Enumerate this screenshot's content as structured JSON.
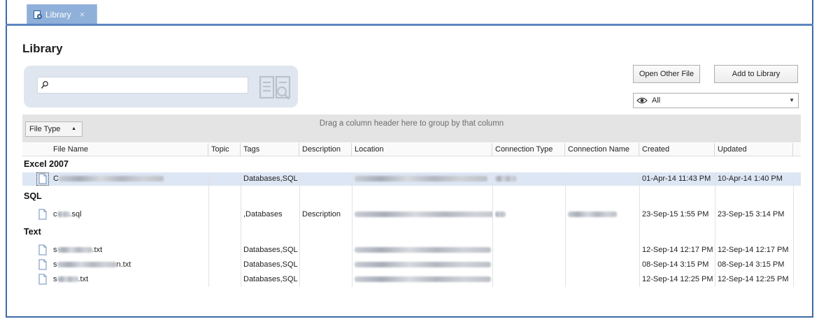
{
  "tab": {
    "label": "Library",
    "close": "×"
  },
  "page": {
    "title": "Library"
  },
  "search": {
    "value": "",
    "placeholder": ""
  },
  "buttons": {
    "open_other_file": "Open Other File",
    "add_to_library": "Add to Library"
  },
  "filter": {
    "selected": "All"
  },
  "grouping": {
    "hint": "Drag a column header here to group by that column",
    "chip_label": "File Type",
    "chip_sort": "▲"
  },
  "columns": [
    "File Name",
    "Topic",
    "Tags",
    "Description",
    "Location",
    "Connection Type",
    "Connection Name",
    "Created",
    "Updated"
  ],
  "groups": [
    {
      "name": "Excel 2007",
      "rows": [
        {
          "file_prefix": "C",
          "file_suffix": "",
          "topic": "",
          "tags": "Databases,SQL",
          "description": "",
          "created": "01-Apr-14 11:43 PM",
          "updated": "10-Apr-14 1:40 PM",
          "selected": true
        }
      ]
    },
    {
      "name": "SQL",
      "rows": [
        {
          "file_prefix": "c",
          "file_suffix": ".sql",
          "topic": "",
          "tags": ",Databases",
          "description": "Description",
          "created": "23-Sep-15 1:55 PM",
          "updated": "23-Sep-15 3:14 PM",
          "selected": false
        }
      ]
    },
    {
      "name": "Text",
      "rows": [
        {
          "file_prefix": "s",
          "file_suffix": ".txt",
          "topic": "",
          "tags": "Databases,SQL",
          "description": "",
          "created": "12-Sep-14 12:17 PM",
          "updated": "12-Sep-14 12:17 PM",
          "selected": false
        },
        {
          "file_prefix": "s",
          "file_suffix": "n.txt",
          "topic": "",
          "tags": "Databases,SQL",
          "description": "",
          "created": "08-Sep-14 3:15 PM",
          "updated": "08-Sep-14 3:15 PM",
          "selected": false
        },
        {
          "file_prefix": "s",
          "file_suffix": ".txt",
          "topic": "",
          "tags": "Databases,SQL",
          "description": "",
          "created": "12-Sep-14 12:25 PM",
          "updated": "12-Sep-14 12:25 PM",
          "selected": false
        }
      ]
    }
  ],
  "icons": {
    "search": "search-icon",
    "book": "library-book-icon",
    "eye": "eye-icon",
    "file": "file-icon"
  },
  "colors": {
    "titlebar": "#3e6ba3",
    "tab": "#8fb0d9",
    "selected_row": "#dde6f4",
    "group_panel": "#e4e4e4"
  }
}
